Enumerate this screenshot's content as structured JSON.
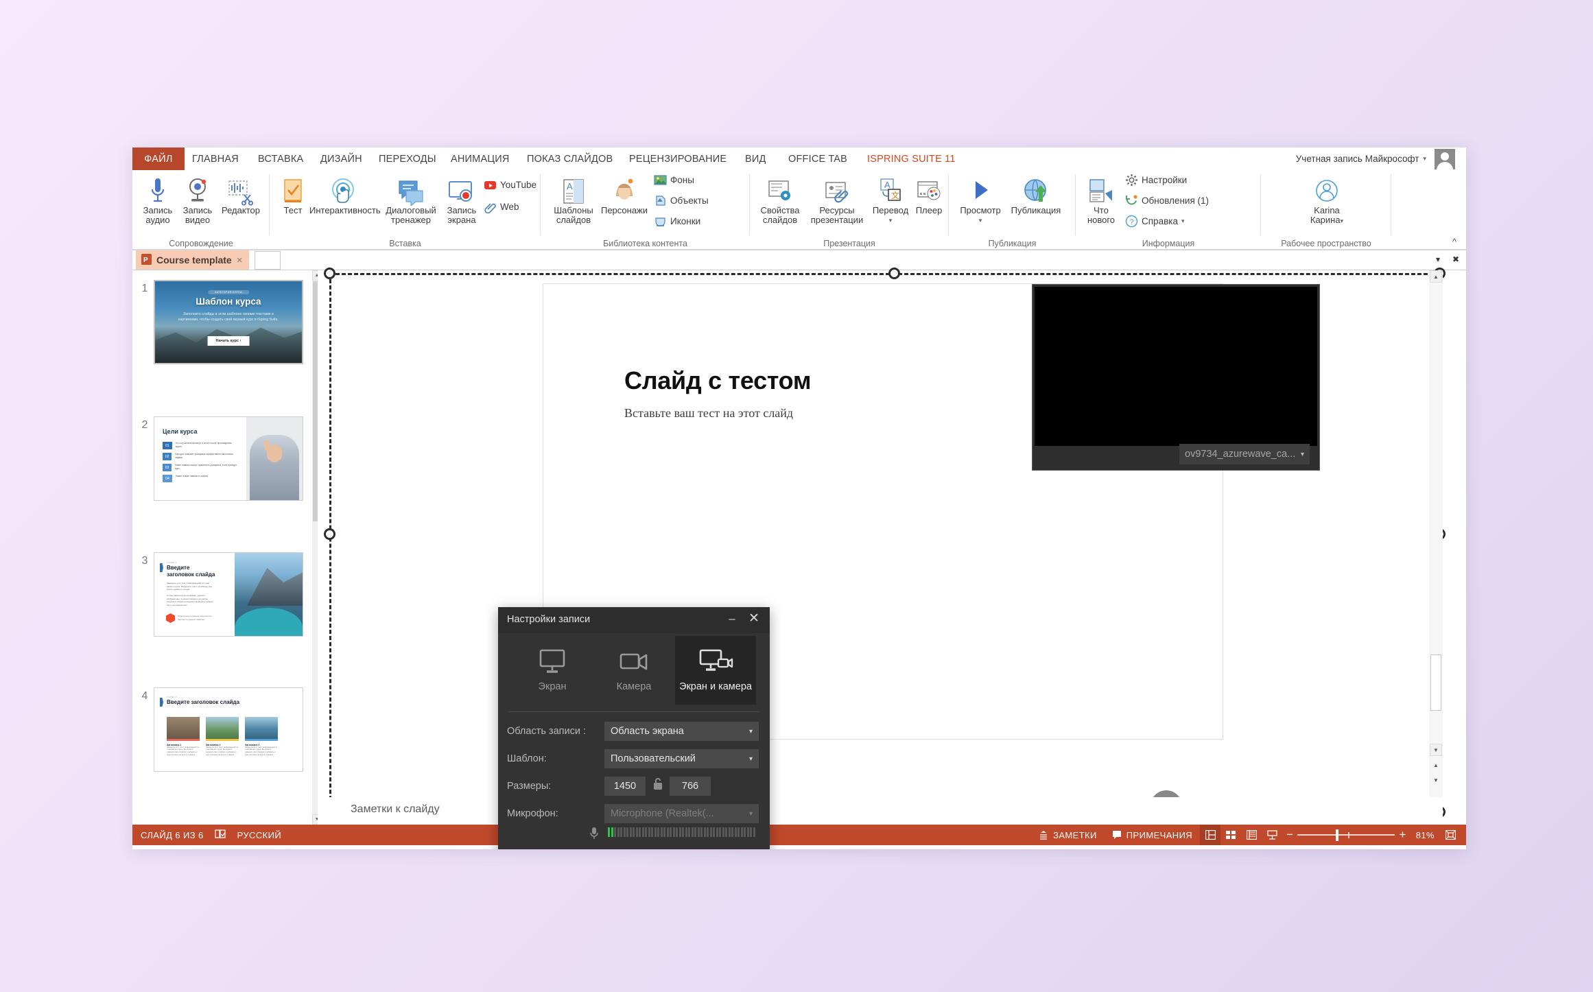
{
  "ribbon_tabs": [
    {
      "label": "ФАЙЛ",
      "kind": "file"
    },
    {
      "label": "ГЛАВНАЯ"
    },
    {
      "label": "ВСТАВКА"
    },
    {
      "label": "ДИЗАЙН"
    },
    {
      "label": "ПЕРЕХОДЫ"
    },
    {
      "label": "АНИМАЦИЯ"
    },
    {
      "label": "ПОКАЗ СЛАЙДОВ"
    },
    {
      "label": "РЕЦЕНЗИРОВАНИЕ"
    },
    {
      "label": "ВИД"
    },
    {
      "label": "OFFICE TAB"
    },
    {
      "label": "ISPRING SUITE 11",
      "kind": "ispring"
    }
  ],
  "account": {
    "label": "Учетная запись Майкрософт",
    "caret": "▾"
  },
  "groups": [
    {
      "title": "Сопровождение",
      "buttons": [
        {
          "label1": "Запись",
          "label2": "аудио",
          "icon": "microphone-icon"
        },
        {
          "label1": "Запись",
          "label2": "видео",
          "icon": "webcam-icon"
        },
        {
          "label1": "Редактор",
          "label2": "",
          "icon": "waveform-scissors-icon"
        }
      ]
    },
    {
      "title": "Вставка",
      "buttons": [
        {
          "label1": "Тест",
          "label2": "",
          "icon": "quiz-checkmark-icon"
        },
        {
          "label1": "Интерактивность",
          "label2": "",
          "icon": "interaction-touch-icon"
        },
        {
          "label1": "Диалоговый",
          "label2": "тренажер",
          "icon": "dialog-simulation-icon"
        },
        {
          "label1": "Запись",
          "label2": "экрана",
          "icon": "screen-record-icon"
        }
      ],
      "minis": [
        {
          "label": "YouTube",
          "icon": "youtube-icon"
        },
        {
          "label": "Web",
          "icon": "web-link-icon"
        }
      ]
    },
    {
      "title": "Библиотека контента",
      "buttons": [
        {
          "label1": "Шаблоны",
          "label2": "слайдов",
          "icon": "slide-templates-icon"
        },
        {
          "label1": "Персонажи",
          "label2": "",
          "icon": "characters-icon"
        }
      ],
      "minis": [
        {
          "label": "Фоны",
          "icon": "backgrounds-icon"
        },
        {
          "label": "Объекты",
          "icon": "objects-icon"
        },
        {
          "label": "Иконки",
          "icon": "icons-icon"
        }
      ]
    },
    {
      "title": "Презентация",
      "buttons": [
        {
          "label1": "Свойства",
          "label2": "слайдов",
          "icon": "slide-properties-icon"
        },
        {
          "label1": "Ресурсы",
          "label2": "презентации",
          "icon": "presentation-resources-icon"
        },
        {
          "label1": "Перевод",
          "label2": "",
          "icon": "translate-icon",
          "caret": "▾"
        },
        {
          "label1": "Плеер",
          "label2": "",
          "icon": "player-icon"
        }
      ]
    },
    {
      "title": "Публикация",
      "buttons": [
        {
          "label1": "Просмотр",
          "label2": "",
          "icon": "preview-play-icon",
          "caret": "▾"
        },
        {
          "label1": "Публикация",
          "label2": "",
          "icon": "publish-globe-icon"
        }
      ]
    },
    {
      "title": "Информация",
      "buttons": [
        {
          "label1": "Что",
          "label2": "нового",
          "icon": "whats-new-icon"
        }
      ],
      "minis": [
        {
          "label": "Настройки",
          "icon": "settings-gear-icon"
        },
        {
          "label": "Обновления (1)",
          "icon": "updates-refresh-icon"
        },
        {
          "label": "Справка",
          "icon": "help-question-icon",
          "caret": "▾"
        }
      ]
    },
    {
      "title": "Рабочее пространство",
      "buttons": [
        {
          "label1": "Karina",
          "label2": "Карина",
          "icon": "user-account-icon",
          "caret": "▾"
        }
      ]
    }
  ],
  "doc_tab": {
    "title": "Course template",
    "close": "×",
    "icon": "powerpoint-file-icon"
  },
  "doc_bar_right": {
    "caret": "▾",
    "close": "✖"
  },
  "thumbnails": [
    {
      "number": "1",
      "title": "Шаблон курса",
      "badge": "КАТЕГОРИЯ КУРСА",
      "body": "Заполните слайды в этом шаблоне своими текстами и картинками, чтобы создать свой первый курс в iSpring Suite.",
      "button": "Начать курс ›",
      "layout": "hero"
    },
    {
      "number": "2",
      "title": "Цели курса",
      "layout": "goals",
      "items": [
        {
          "num": "01",
          "text": "Что слушатели вынесут в итоге после прохождения курса."
        },
        {
          "num": "02",
          "text": "Как курс поможет учащимся эффективнее выполнять задачи."
        },
        {
          "num": "03",
          "text": "Какие навыки смогут применить учащиеся, если пройдут курс."
        },
        {
          "num": "04",
          "text": "Какие новые навыки и знания."
        }
      ]
    },
    {
      "number": "3",
      "eyebrow": "ГЛАВА 1",
      "title": "Введите заголовок слайда",
      "layout": "text-image",
      "para1": "Замените этот текст информацией по теме вашего курса. Разделите текст на абзацы для более удобного чтения.",
      "para2": "Чтобы заменить фотографию, удалите изображение, а затем кликните на значок рисунка в области холдера и выберите нужное фото на компьютере.",
      "tip": "Поделитесь полезным советом или фактом по данной тематике."
    },
    {
      "number": "4",
      "eyebrow": "ГЛАВА 1",
      "title": "Введите заголовок слайда",
      "layout": "three-cards",
      "cards": [
        {
          "title": "Заголовок 1",
          "text": "Замените этот текст информацией по теме вашего курса. Вы можете заменить фотографии и добавить к ним описания на других слайдах."
        },
        {
          "title": "Заголовок 2",
          "text": "Замените этот текст информацией по теме вашего курса. Вы можете заменить фотографии и добавить к ним описания на других слайдах."
        },
        {
          "title": "Заголовок 3",
          "text": "Замените этот текст информацией по теме вашего курса. Вы можете заменить фотографии и добавить к ним описания на других слайдах."
        }
      ]
    }
  ],
  "slide": {
    "title": "Слайд с тестом",
    "subtitle": "Вставьте ваш тест на этот слайд"
  },
  "camera_overlay": {
    "device": "ov9734_azurewave_ca...",
    "caret": "▾"
  },
  "notes": {
    "placeholder": "Заметки к слайду"
  },
  "status_bar": {
    "slide_counter": "СЛАЙД 6 ИЗ 6",
    "language": "РУССКИЙ",
    "spellcheck_icon": "spellcheck-icon",
    "notes_label": "ЗАМЕТКИ",
    "comments_label": "ПРИМЕЧАНИЯ",
    "zoom_percent": "81%",
    "zoom_minus": "−",
    "zoom_plus": "+",
    "views": [
      "normal-view-icon",
      "slide-sorter-icon",
      "reading-view-icon",
      "slideshow-icon"
    ],
    "fit_icon": "fit-slide-icon"
  },
  "record_dialog": {
    "title": "Настройки записи",
    "minimize": "–",
    "close": "✕",
    "modes": [
      {
        "label": "Экран",
        "icon": "monitor-icon",
        "active": false
      },
      {
        "label": "Камера",
        "icon": "camera-icon",
        "active": false
      },
      {
        "label": "Экран и камера",
        "icon": "monitor-camera-icon",
        "active": true
      }
    ],
    "fields": [
      {
        "label": "Область записи :",
        "value": "Область экрана",
        "caret": "▾",
        "type": "select",
        "disabled": false
      },
      {
        "label": "Шаблон:",
        "value": "Пользовательский",
        "caret": "▾",
        "type": "select",
        "disabled": false
      },
      {
        "label": "Размеры:",
        "width": "1450",
        "height": "766",
        "lock_icon": "unlock-icon",
        "type": "size"
      },
      {
        "label": "Микрофон:",
        "value": "Microphone (Realtek(...",
        "caret": "▾",
        "type": "select",
        "disabled": true
      }
    ],
    "mic_icon": "microphone-small-icon",
    "meter_active_bars": 2,
    "meter_total_bars": 48,
    "gear_icon": "settings-gear-icon",
    "record_button": "record-button"
  },
  "colors": {
    "accent_red": "#c0492b",
    "file_tab": "#b7472a",
    "ispring_orange": "#d1481f",
    "doc_tab_bg": "#f8cbb4",
    "dialog_bg": "#333333",
    "record_red": "#ee3333",
    "meter_green": "#2fc14c"
  }
}
